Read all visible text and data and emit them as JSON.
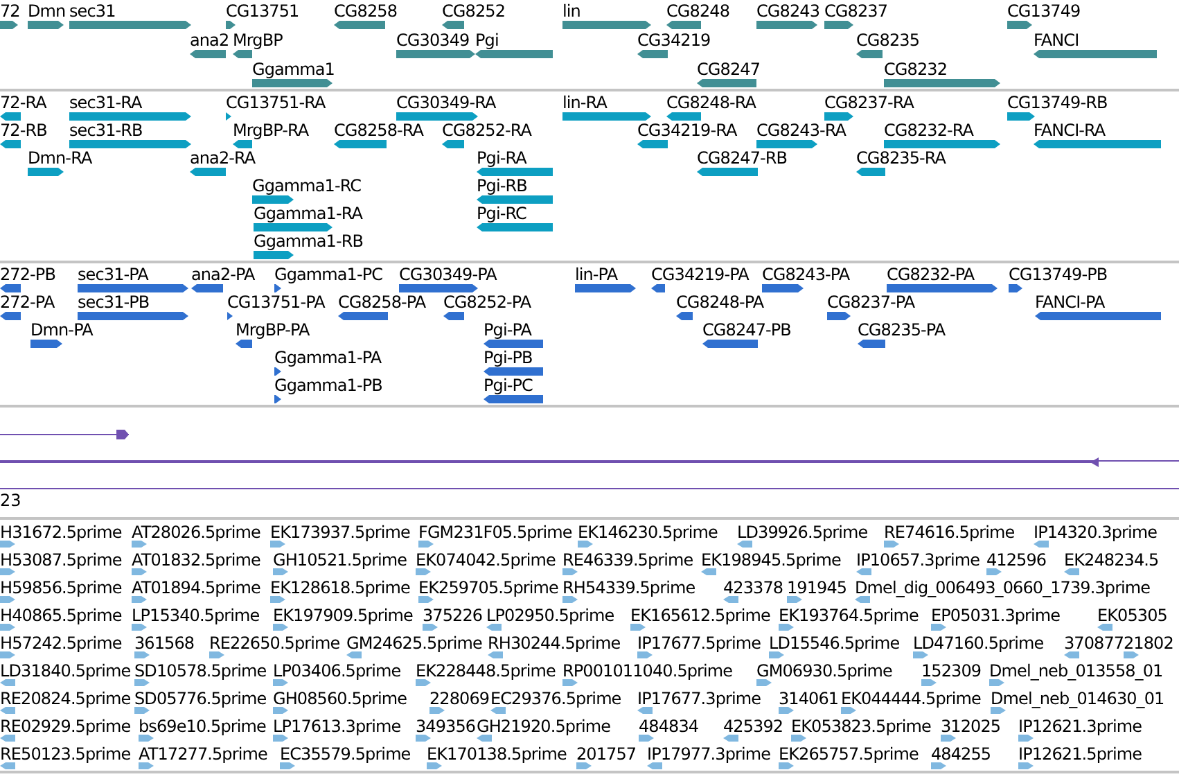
{
  "tracks": [
    {
      "kind": "genes",
      "features": [
        {
          "label": "72",
          "reverse": false
        },
        {
          "label": "Dmn",
          "reverse": false
        },
        {
          "label": "sec31",
          "reverse": false
        },
        {
          "label": "CG13751",
          "reverse": false
        },
        {
          "label": "CG8258",
          "reverse": true
        },
        {
          "label": "CG8252",
          "reverse": true
        },
        {
          "label": "lin",
          "reverse": false
        },
        {
          "label": "CG8248",
          "reverse": true
        },
        {
          "label": "CG8243",
          "reverse": false
        },
        {
          "label": "CG8237",
          "reverse": false
        },
        {
          "label": "CG13749",
          "reverse": false
        },
        {
          "label": "ana2",
          "reverse": true
        },
        {
          "label": "MrgBP",
          "reverse": true
        },
        {
          "label": "CG30349",
          "reverse": false
        },
        {
          "label": "Pgi",
          "reverse": true
        },
        {
          "label": "CG34219",
          "reverse": true
        },
        {
          "label": "CG8235",
          "reverse": true
        },
        {
          "label": "FANCI",
          "reverse": true
        },
        {
          "label": "Ggamma1",
          "reverse": false
        },
        {
          "label": "CG8247",
          "reverse": true
        },
        {
          "label": "CG8232",
          "reverse": false
        }
      ]
    },
    {
      "kind": "transcripts",
      "features": [
        {
          "label": "72-RA",
          "reverse": true
        },
        {
          "label": "sec31-RA",
          "reverse": false
        },
        {
          "label": "CG13751-RA",
          "reverse": false
        },
        {
          "label": "CG30349-RA",
          "reverse": false
        },
        {
          "label": "lin-RA",
          "reverse": false
        },
        {
          "label": "CG8248-RA",
          "reverse": true
        },
        {
          "label": "CG8237-RA",
          "reverse": false
        },
        {
          "label": "CG13749-RB",
          "reverse": false
        },
        {
          "label": "72-RB",
          "reverse": true
        },
        {
          "label": "sec31-RB",
          "reverse": false
        },
        {
          "label": "MrgBP-RA",
          "reverse": true
        },
        {
          "label": "CG8258-RA",
          "reverse": true
        },
        {
          "label": "CG8252-RA",
          "reverse": true
        },
        {
          "label": "CG34219-RA",
          "reverse": true
        },
        {
          "label": "CG8243-RA",
          "reverse": false
        },
        {
          "label": "CG8232-RA",
          "reverse": false
        },
        {
          "label": "FANCI-RA",
          "reverse": true
        },
        {
          "label": "Dmn-RA",
          "reverse": false
        },
        {
          "label": "ana2-RA",
          "reverse": true
        },
        {
          "label": "Pgi-RA",
          "reverse": true
        },
        {
          "label": "CG8247-RB",
          "reverse": true
        },
        {
          "label": "CG8235-RA",
          "reverse": true
        },
        {
          "label": "Ggamma1-RC",
          "reverse": false
        },
        {
          "label": "Pgi-RB",
          "reverse": true
        },
        {
          "label": "Ggamma1-RA",
          "reverse": false
        },
        {
          "label": "Pgi-RC",
          "reverse": true
        },
        {
          "label": "Ggamma1-RB",
          "reverse": false
        }
      ]
    },
    {
      "kind": "proteins",
      "features": [
        {
          "label": "272-PB",
          "reverse": true
        },
        {
          "label": "sec31-PA",
          "reverse": false
        },
        {
          "label": "ana2-PA",
          "reverse": true
        },
        {
          "label": "Ggamma1-PC",
          "reverse": false
        },
        {
          "label": "CG30349-PA",
          "reverse": false
        },
        {
          "label": "lin-PA",
          "reverse": false
        },
        {
          "label": "CG34219-PA",
          "reverse": true
        },
        {
          "label": "CG8243-PA",
          "reverse": false
        },
        {
          "label": "CG8232-PA",
          "reverse": false
        },
        {
          "label": "CG13749-PB",
          "reverse": false
        },
        {
          "label": "272-PA",
          "reverse": true
        },
        {
          "label": "sec31-PB",
          "reverse": false
        },
        {
          "label": "CG13751-PA",
          "reverse": false
        },
        {
          "label": "CG8258-PA",
          "reverse": true
        },
        {
          "label": "CG8252-PA",
          "reverse": true
        },
        {
          "label": "CG8248-PA",
          "reverse": true
        },
        {
          "label": "CG8237-PA",
          "reverse": false
        },
        {
          "label": "FANCI-PA",
          "reverse": true
        },
        {
          "label": "Dmn-PA",
          "reverse": false
        },
        {
          "label": "MrgBP-PA",
          "reverse": true
        },
        {
          "label": "Pgi-PA",
          "reverse": true
        },
        {
          "label": "CG8247-PB",
          "reverse": true
        },
        {
          "label": "CG8235-PA",
          "reverse": true
        },
        {
          "label": "Ggamma1-PA",
          "reverse": false
        },
        {
          "label": "Pgi-PB",
          "reverse": true
        },
        {
          "label": "Ggamma1-PB",
          "reverse": false
        },
        {
          "label": "Pgi-PC",
          "reverse": true
        }
      ]
    },
    {
      "kind": "lines",
      "features": [
        {
          "reverse": false
        },
        {
          "reverse": true
        }
      ],
      "label": "23"
    },
    {
      "kind": "ests",
      "features": [
        {
          "label": "H31672.5prime",
          "reverse": false
        },
        {
          "label": "AT28026.5prime",
          "reverse": false
        },
        {
          "label": "EK173937.5prime",
          "reverse": false
        },
        {
          "label": "FGM231F05.5prime",
          "reverse": false
        },
        {
          "label": "EK146230.5prime",
          "reverse": false
        },
        {
          "label": "LD39926.5prime",
          "reverse": true
        },
        {
          "label": "RE74616.5prime",
          "reverse": false
        },
        {
          "label": "IP14320.3prime",
          "reverse": true
        },
        {
          "label": "H53087.5prime",
          "reverse": false
        },
        {
          "label": "AT01832.5prime",
          "reverse": false
        },
        {
          "label": "GH10521.5prime",
          "reverse": false
        },
        {
          "label": "EK074042.5prime",
          "reverse": false
        },
        {
          "label": "RE46339.5prime",
          "reverse": false
        },
        {
          "label": "EK198945.5prime",
          "reverse": true
        },
        {
          "label": "IP10657.3prime",
          "reverse": true
        },
        {
          "label": "412596",
          "reverse": false
        },
        {
          "label": "EK248234.5",
          "reverse": true
        },
        {
          "label": "H59856.5prime",
          "reverse": false
        },
        {
          "label": "AT01894.5prime",
          "reverse": false
        },
        {
          "label": "EK128618.5prime",
          "reverse": false
        },
        {
          "label": "EK259705.5prime",
          "reverse": false
        },
        {
          "label": "RH54339.5prime",
          "reverse": false
        },
        {
          "label": "423378",
          "reverse": true
        },
        {
          "label": "191945",
          "reverse": false
        },
        {
          "label": "Dmel_dig_006493_0660_1739.3prime",
          "reverse": true
        },
        {
          "label": "H40865.5prime",
          "reverse": false
        },
        {
          "label": "LP15340.5prime",
          "reverse": false
        },
        {
          "label": "EK197909.5prime",
          "reverse": false
        },
        {
          "label": "375226",
          "reverse": false
        },
        {
          "label": "LP02950.5prime",
          "reverse": true
        },
        {
          "label": "EK165612.5prime",
          "reverse": false
        },
        {
          "label": "EK193764.5prime",
          "reverse": false
        },
        {
          "label": "EP05031.3prime",
          "reverse": false
        },
        {
          "label": "EK05305",
          "reverse": true
        },
        {
          "label": "H57242.5prime",
          "reverse": false
        },
        {
          "label": "361568",
          "reverse": false
        },
        {
          "label": "RE22650.5prime",
          "reverse": false
        },
        {
          "label": "GM24625.5prime",
          "reverse": true
        },
        {
          "label": "RH30244.5prime",
          "reverse": true
        },
        {
          "label": "IP17677.5prime",
          "reverse": false
        },
        {
          "label": "LD15546.5prime",
          "reverse": false
        },
        {
          "label": "LD47160.5prime",
          "reverse": false
        },
        {
          "label": "370877",
          "reverse": true
        },
        {
          "label": "21802",
          "reverse": false
        },
        {
          "label": "LD31840.5prime",
          "reverse": true
        },
        {
          "label": "SD10578.5prime",
          "reverse": false
        },
        {
          "label": "LP03406.5prime",
          "reverse": false
        },
        {
          "label": "EK228448.5prime",
          "reverse": false
        },
        {
          "label": "RP001011040.5prime",
          "reverse": false
        },
        {
          "label": "GM06930.5prime",
          "reverse": false
        },
        {
          "label": "152309",
          "reverse": false
        },
        {
          "label": "Dmel_neb_013558_01",
          "reverse": false
        },
        {
          "label": "RE20824.5prime",
          "reverse": true
        },
        {
          "label": "SD05776.5prime",
          "reverse": false
        },
        {
          "label": "GH08560.5prime",
          "reverse": false
        },
        {
          "label": "228069",
          "reverse": false
        },
        {
          "label": "EC29376.5prime",
          "reverse": true
        },
        {
          "label": "IP17677.3prime",
          "reverse": true
        },
        {
          "label": "314061",
          "reverse": false
        },
        {
          "label": "EK044444.5prime",
          "reverse": false
        },
        {
          "label": "Dmel_neb_014630_01",
          "reverse": false
        },
        {
          "label": "RE02929.5prime",
          "reverse": true
        },
        {
          "label": "bs69e10.5prime",
          "reverse": false
        },
        {
          "label": "LP17613.3prime",
          "reverse": false
        },
        {
          "label": "349356",
          "reverse": false
        },
        {
          "label": "GH21920.5prime",
          "reverse": true
        },
        {
          "label": "484834",
          "reverse": false
        },
        {
          "label": "425392",
          "reverse": true
        },
        {
          "label": "EK053823.5prime",
          "reverse": false
        },
        {
          "label": "312025",
          "reverse": false
        },
        {
          "label": "IP12621.3prime",
          "reverse": false
        },
        {
          "label": "RE50123.5prime",
          "reverse": true
        },
        {
          "label": "AT17277.5prime",
          "reverse": false
        },
        {
          "label": "EC35579.5prime",
          "reverse": false
        },
        {
          "label": "EK170138.5prime",
          "reverse": false
        },
        {
          "label": "201757",
          "reverse": false
        },
        {
          "label": "IP17977.3prime",
          "reverse": true
        },
        {
          "label": "EK265757.5prime",
          "reverse": false
        },
        {
          "label": "484255",
          "reverse": false
        },
        {
          "label": "IP12621.5prime",
          "reverse": false
        }
      ]
    }
  ]
}
